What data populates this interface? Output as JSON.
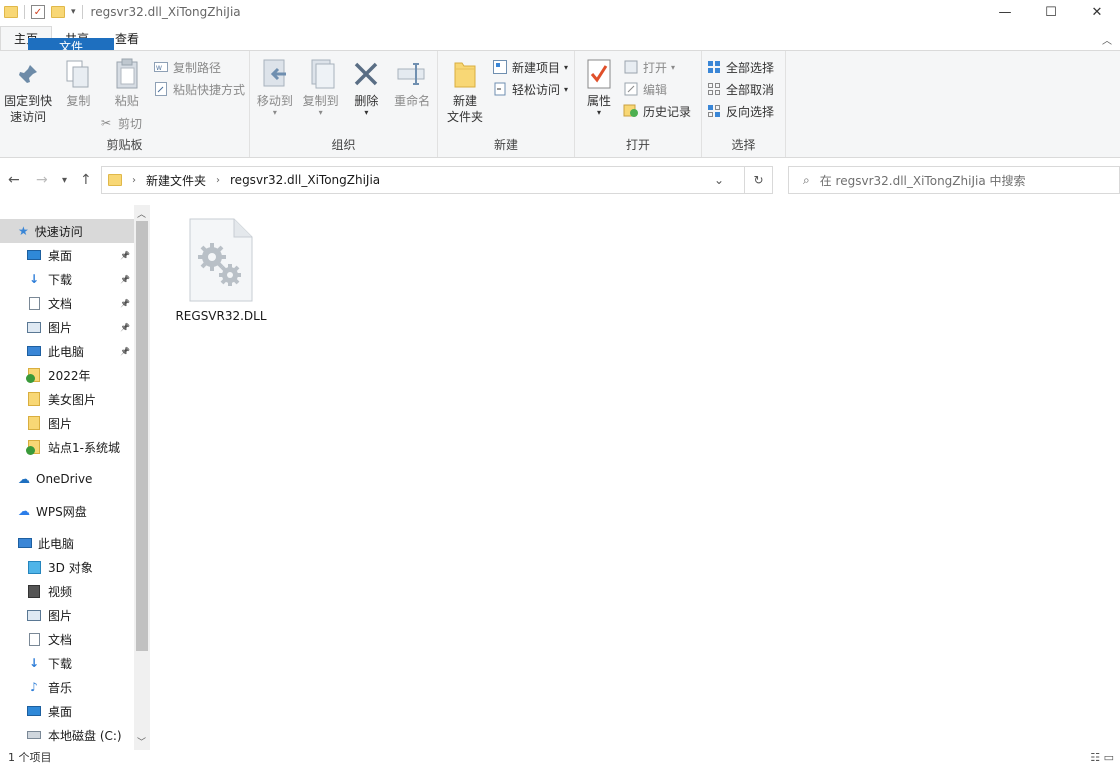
{
  "window": {
    "title": "regsvr32.dll_XiTongZhiJia",
    "minimize": "—",
    "maximize": "☐",
    "close": "✕"
  },
  "tabs": [
    "文件",
    "主页",
    "共享",
    "查看"
  ],
  "ribbon": {
    "clipboard": {
      "label": "剪贴板",
      "pin": "固定到快速访问",
      "pin_line1": "固定到快",
      "pin_line2": "速访问",
      "copy": "复制",
      "paste": "粘贴",
      "copy_path": "复制路径",
      "paste_shortcut": "粘贴快捷方式",
      "cut": "剪切"
    },
    "organize": {
      "label": "组织",
      "move_to": "移动到",
      "copy_to": "复制到",
      "delete": "删除",
      "rename": "重命名"
    },
    "new": {
      "label": "新建",
      "new_folder_line1": "新建",
      "new_folder_line2": "文件夹",
      "new_item": "新建项目",
      "easy_access": "轻松访问"
    },
    "open": {
      "label": "打开",
      "properties": "属性",
      "open": "打开",
      "edit": "编辑",
      "history": "历史记录"
    },
    "select": {
      "label": "选择",
      "select_all": "全部选择",
      "select_none": "全部取消",
      "invert": "反向选择"
    }
  },
  "address": {
    "crumbs": [
      "新建文件夹",
      "regsvr32.dll_XiTongZhiJia"
    ],
    "search_placeholder": "在 regsvr32.dll_XiTongZhiJia 中搜索"
  },
  "nav": {
    "quick_access": "快速访问",
    "quick_items": [
      {
        "label": "桌面",
        "icon": "desktop-icon",
        "pinned": true
      },
      {
        "label": "下载",
        "icon": "download-icon",
        "pinned": true
      },
      {
        "label": "文档",
        "icon": "document-icon",
        "pinned": true
      },
      {
        "label": "图片",
        "icon": "picture-icon",
        "pinned": true
      },
      {
        "label": "此电脑",
        "icon": "computer-icon",
        "pinned": true
      },
      {
        "label": "2022年",
        "icon": "folder-sync-icon",
        "pinned": false
      },
      {
        "label": "美女图片",
        "icon": "folder-icon",
        "pinned": false
      },
      {
        "label": "图片",
        "icon": "folder-icon",
        "pinned": false
      },
      {
        "label": "站点1-系统城",
        "icon": "folder-sync-icon",
        "pinned": false
      }
    ],
    "onedrive": "OneDrive",
    "wps": "WPS网盘",
    "this_pc": "此电脑",
    "pc_items": [
      {
        "label": "3D 对象",
        "icon": "3d-objects-icon"
      },
      {
        "label": "视频",
        "icon": "video-icon"
      },
      {
        "label": "图片",
        "icon": "picture-icon"
      },
      {
        "label": "文档",
        "icon": "document-icon"
      },
      {
        "label": "下载",
        "icon": "download-icon"
      },
      {
        "label": "音乐",
        "icon": "music-icon"
      },
      {
        "label": "桌面",
        "icon": "desktop-icon"
      },
      {
        "label": "本地磁盘 (C:)",
        "icon": "drive-icon"
      }
    ]
  },
  "content": {
    "files": [
      {
        "name": "REGSVR32.DLL",
        "icon": "dll-file-icon"
      }
    ]
  },
  "status": {
    "count": "1 个项目"
  },
  "colors": {
    "file_tab": "#1e6fbf",
    "selected_nav": "#d9d9d9",
    "folder": "#f8d775"
  }
}
